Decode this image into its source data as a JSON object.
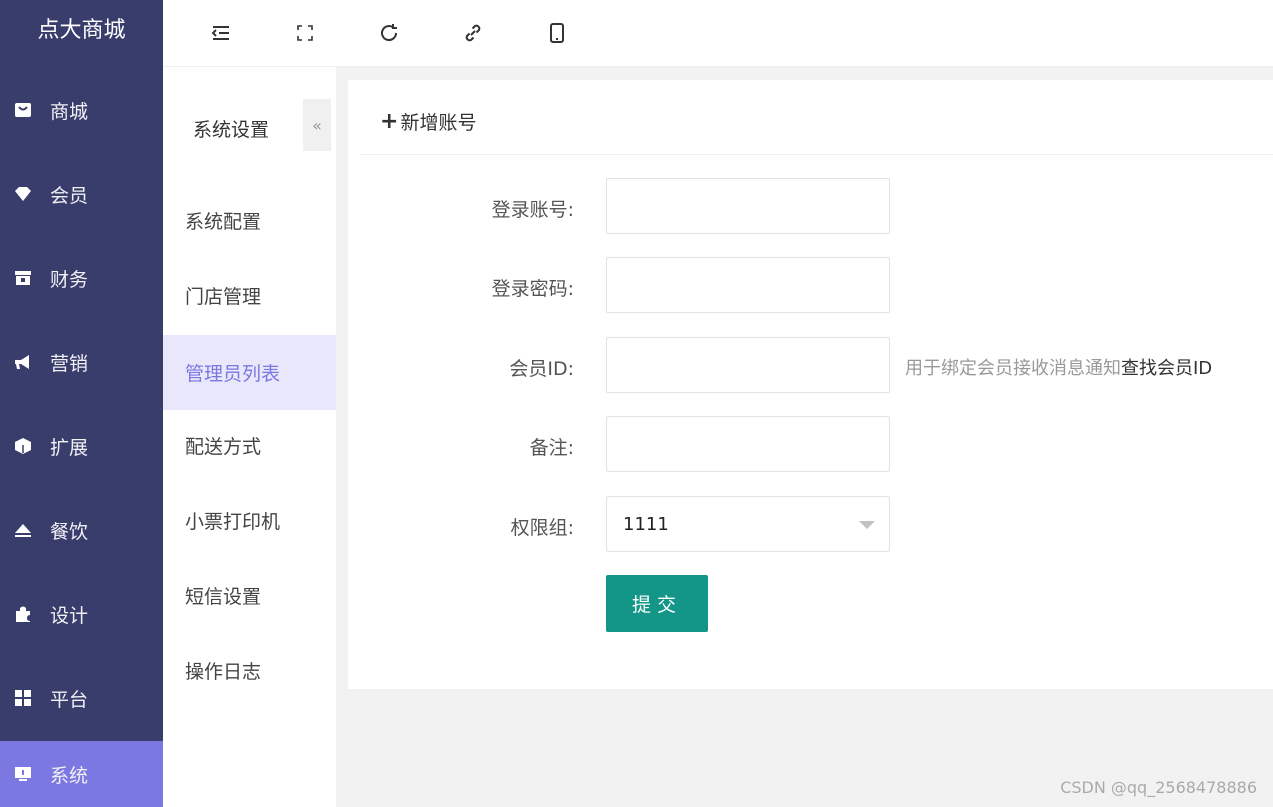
{
  "brand": "点大商城",
  "sidebar": {
    "items": [
      {
        "label": "商城",
        "icon": "store-icon"
      },
      {
        "label": "会员",
        "icon": "diamond-icon"
      },
      {
        "label": "财务",
        "icon": "wallet-icon"
      },
      {
        "label": "营销",
        "icon": "megaphone-icon"
      },
      {
        "label": "扩展",
        "icon": "cube-icon"
      },
      {
        "label": "餐饮",
        "icon": "eject-icon"
      },
      {
        "label": "设计",
        "icon": "puzzle-icon"
      },
      {
        "label": "平台",
        "icon": "grid-icon"
      },
      {
        "label": "系统",
        "icon": "monitor-icon",
        "active": true
      }
    ],
    "active_color": "#7b78e1",
    "bg_color": "#393d6c"
  },
  "toolbar": {
    "icons": [
      "menu-fold-icon",
      "fullscreen-icon",
      "refresh-icon",
      "link-icon",
      "mobile-icon"
    ]
  },
  "submenu": {
    "title": "系统设置",
    "collapse_glyph": "«",
    "items": [
      {
        "label": "系统配置"
      },
      {
        "label": "门店管理"
      },
      {
        "label": "管理员列表",
        "active": true
      },
      {
        "label": "配送方式"
      },
      {
        "label": "小票打印机"
      },
      {
        "label": "短信设置"
      },
      {
        "label": "操作日志"
      }
    ]
  },
  "main": {
    "add_label": "新增账号",
    "form": {
      "account_label": "登录账号:",
      "account_value": "",
      "password_label": "登录密码:",
      "password_value": "",
      "member_id_label": "会员ID:",
      "member_id_value": "",
      "member_id_hint": "用于绑定会员接收消息通知",
      "member_id_link": "查找会员ID",
      "remark_label": "备注:",
      "remark_value": "",
      "group_label": "权限组:",
      "group_value": "1111"
    },
    "submit_label": "提交",
    "submit_color": "#139688"
  },
  "watermark": "CSDN @qq_2568478886"
}
